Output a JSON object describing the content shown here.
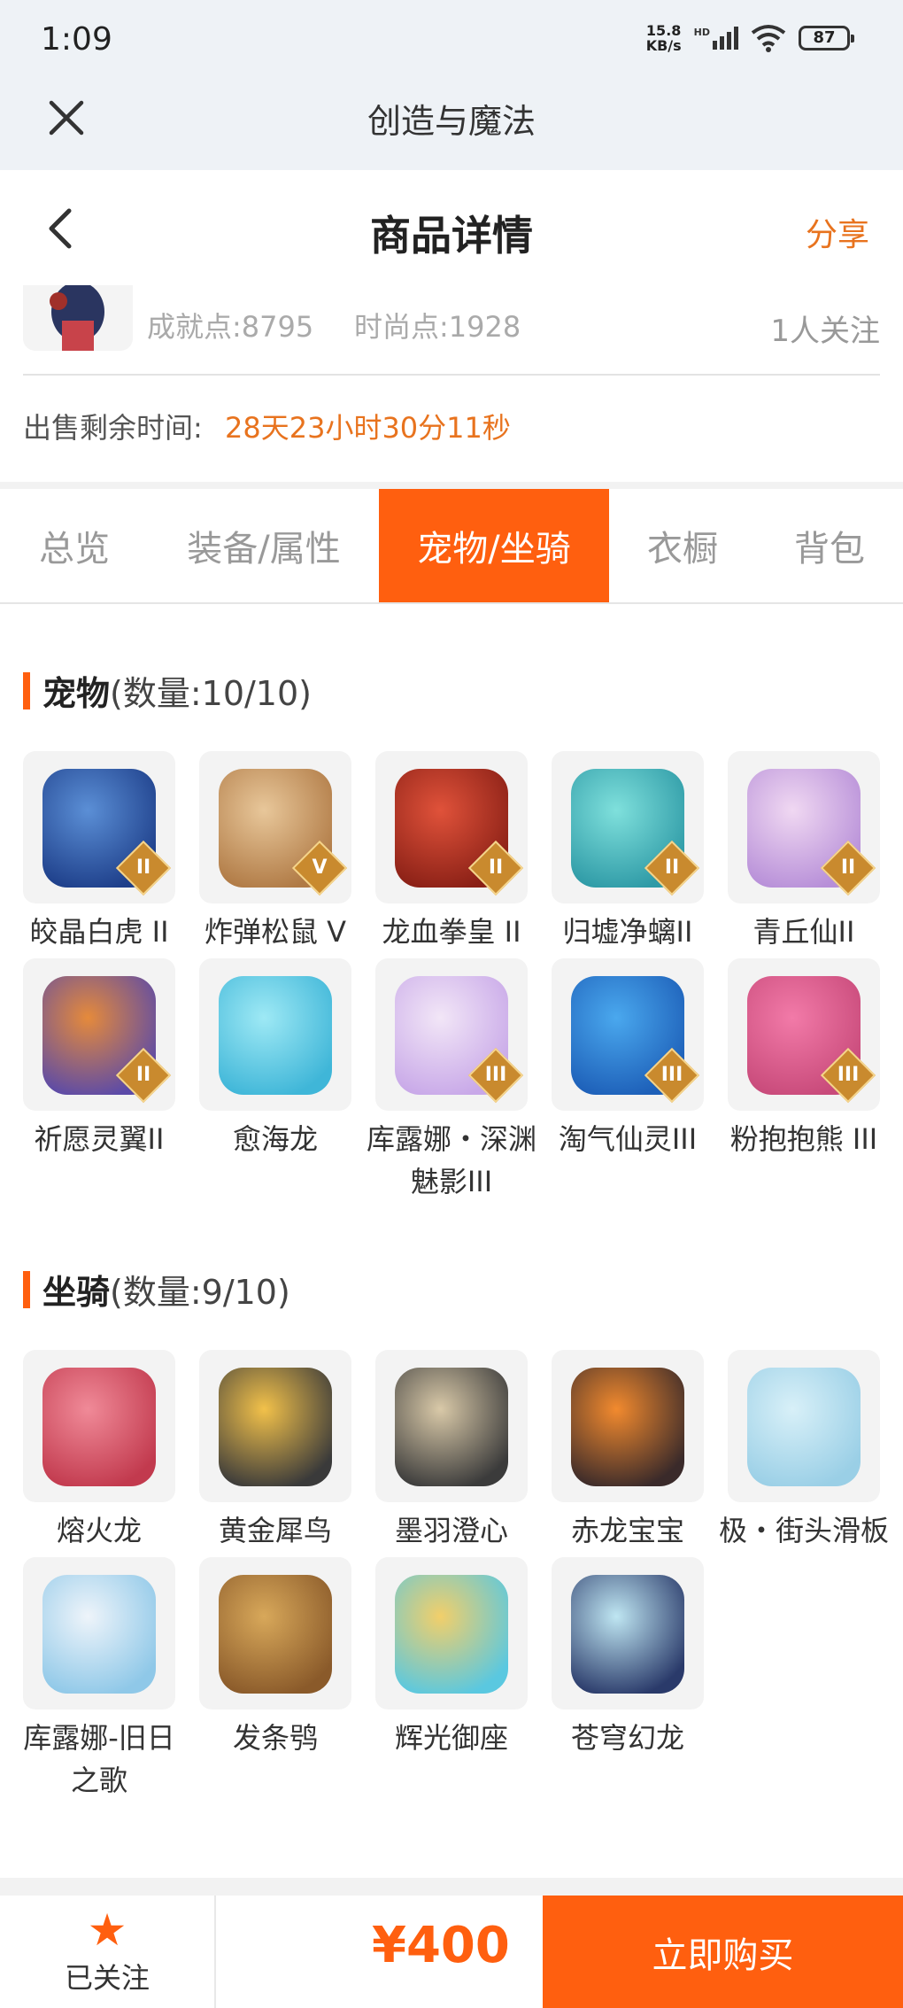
{
  "status_bar": {
    "time": "1:09",
    "net_speed_value": "15.8",
    "net_speed_unit": "KB/s",
    "network_type": "HD",
    "battery": "87"
  },
  "web_bar": {
    "title": "创造与魔法"
  },
  "header": {
    "title": "商品详情",
    "share_label": "分享"
  },
  "info": {
    "achievement": "成就点:8795",
    "fashion": "时尚点:1928",
    "followers": "1人关注",
    "time_label": "出售剩余时间:",
    "time_value": "28天23小时30分11秒"
  },
  "tabs": [
    {
      "label": "总览",
      "active": false
    },
    {
      "label": "装备/属性",
      "active": false
    },
    {
      "label": "宠物/坐骑",
      "active": true
    },
    {
      "label": "衣橱",
      "active": false
    },
    {
      "label": "背包",
      "active": false
    }
  ],
  "pets": {
    "title": "宠物",
    "count": "(数量:10/10)",
    "items": [
      {
        "name": "皎晶白虎 II",
        "badge": "II",
        "colors": [
          "#5b8fd6",
          "#1e3f8a"
        ]
      },
      {
        "name": "炸弹松鼠 V",
        "badge": "V",
        "colors": [
          "#e8c79a",
          "#b07a45"
        ]
      },
      {
        "name": "龙血拳皇 II",
        "badge": "II",
        "colors": [
          "#e0523a",
          "#8a2016"
        ]
      },
      {
        "name": "归墟净螭II",
        "badge": "II",
        "colors": [
          "#7fe0dc",
          "#2e9aa6"
        ]
      },
      {
        "name": "青丘仙II",
        "badge": "II",
        "colors": [
          "#f0d8f2",
          "#b78fd8"
        ]
      },
      {
        "name": "祈愿灵翼II",
        "badge": "II",
        "colors": [
          "#e58a3b",
          "#5b4aa8"
        ]
      },
      {
        "name": "愈海龙",
        "badge": "",
        "colors": [
          "#9ee9f5",
          "#3fb6d8"
        ]
      },
      {
        "name": "库露娜・深渊魅影III",
        "badge": "III",
        "colors": [
          "#f2e6f7",
          "#c8a8e8"
        ]
      },
      {
        "name": "淘气仙灵III",
        "badge": "III",
        "colors": [
          "#4aa8ee",
          "#1d5fb8"
        ]
      },
      {
        "name": "粉抱抱熊 III",
        "badge": "III",
        "colors": [
          "#f27aa8",
          "#c84a7a"
        ]
      }
    ]
  },
  "mounts": {
    "title": "坐骑",
    "count": "(数量:9/10)",
    "items": [
      {
        "name": "熔火龙",
        "badge": "",
        "colors": [
          "#f08a98",
          "#c23a4e"
        ]
      },
      {
        "name": "黄金犀鸟",
        "badge": "",
        "colors": [
          "#f2c14a",
          "#3a3a3a"
        ]
      },
      {
        "name": "墨羽澄心",
        "badge": "",
        "colors": [
          "#d9c9a8",
          "#3b3b3b"
        ]
      },
      {
        "name": "赤龙宝宝",
        "badge": "",
        "colors": [
          "#f28a2e",
          "#3a2a2a"
        ]
      },
      {
        "name": "极・街头滑板",
        "badge": "",
        "colors": [
          "#d8f0f8",
          "#9acfe6"
        ]
      },
      {
        "name": "库露娜-旧日之歌",
        "badge": "",
        "colors": [
          "#eef4fa",
          "#8fc8e8"
        ]
      },
      {
        "name": "发条鸮",
        "badge": "",
        "colors": [
          "#d8a85a",
          "#8a5a2a"
        ]
      },
      {
        "name": "辉光御座",
        "badge": "",
        "colors": [
          "#f2cf6a",
          "#5ac8e0"
        ]
      },
      {
        "name": "苍穹幻龙",
        "badge": "",
        "colors": [
          "#bfe6f2",
          "#2a3a6a"
        ]
      }
    ]
  },
  "bottom": {
    "follow_label": "已关注",
    "price": "¥400",
    "buy_label": "立即购买"
  },
  "colors": {
    "accent": "#ff5f0f",
    "highlight_text": "#e8731e"
  }
}
